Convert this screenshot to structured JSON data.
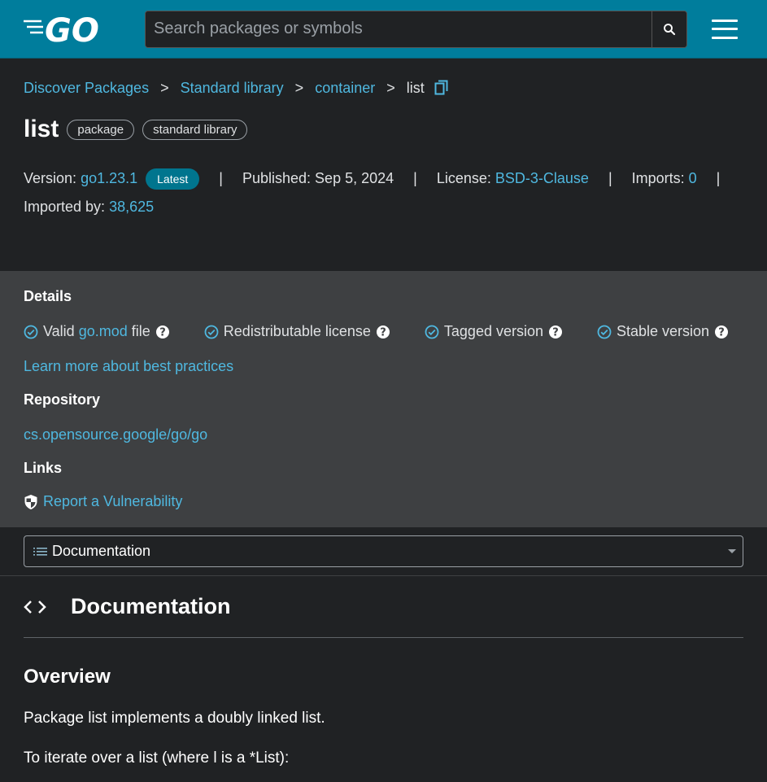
{
  "header": {
    "logo_text": "GO",
    "search_placeholder": "Search packages or symbols"
  },
  "breadcrumb": {
    "items": [
      "Discover Packages",
      "Standard library",
      "container"
    ],
    "separator": ">",
    "current": "list"
  },
  "package": {
    "name": "list",
    "chips": [
      "package",
      "standard library"
    ]
  },
  "meta": {
    "version_label": "Version:",
    "version": "go1.23.1",
    "latest_badge": "Latest",
    "published_label": "Published:",
    "published": "Sep 5, 2024",
    "license_label": "License:",
    "license": "BSD-3-Clause",
    "imports_label": "Imports:",
    "imports": "0",
    "imported_by_label": "Imported by:",
    "imported_by": "38,625",
    "divider": "|"
  },
  "details": {
    "heading": "Details",
    "checks": {
      "valid_prefix": "Valid",
      "valid_link": "go.mod",
      "valid_suffix": "file",
      "redistributable": "Redistributable license",
      "tagged": "Tagged version",
      "stable": "Stable version"
    },
    "learn_more": "Learn more about best practices",
    "repository_heading": "Repository",
    "repository_link": "cs.opensource.google/go/go",
    "links_heading": "Links",
    "vulnerability_link": "Report a Vulnerability"
  },
  "nav_select": {
    "selected": "Documentation"
  },
  "documentation": {
    "heading": "Documentation",
    "overview_heading": "Overview",
    "paragraphs": [
      "Package list implements a doubly linked list.",
      "To iterate over a list (where l is a *List):"
    ]
  },
  "colors": {
    "header_bg": "#007d9c",
    "link": "#4fb8e0",
    "details_bg": "#3e4042",
    "page_bg": "#202224",
    "badge_bg": "#00758e"
  }
}
